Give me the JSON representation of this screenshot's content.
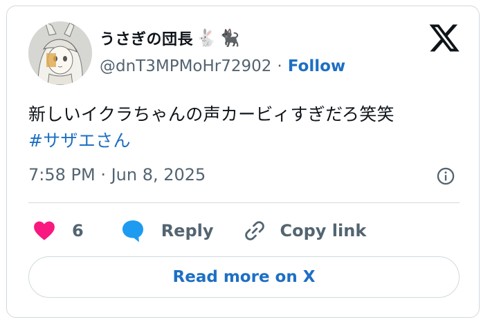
{
  "author": {
    "display_name": "うさぎの団長",
    "name_emojis": [
      "🐇",
      "🐈‍⬛"
    ],
    "handle": "@dnT3MPMoHr72902",
    "separator": "·",
    "follow_label": "Follow",
    "avatar_icon": "anime-girl-avatar"
  },
  "brand": {
    "logo_icon": "x-logo-icon"
  },
  "tweet": {
    "text": "新しいイクラちゃんの声カービィすぎだろ笑笑",
    "hashtag": "#サザエさん",
    "timestamp": "7:58 PM · Jun 8, 2025"
  },
  "actions": {
    "like_count": "6",
    "reply_label": "Reply",
    "copy_link_label": "Copy link"
  },
  "footer": {
    "read_more_label": "Read more on X"
  },
  "colors": {
    "accent": "#1d6fc4",
    "like": "#f91880",
    "reply": "#1d9bf0",
    "muted": "#536471",
    "border": "#cfd9de"
  }
}
